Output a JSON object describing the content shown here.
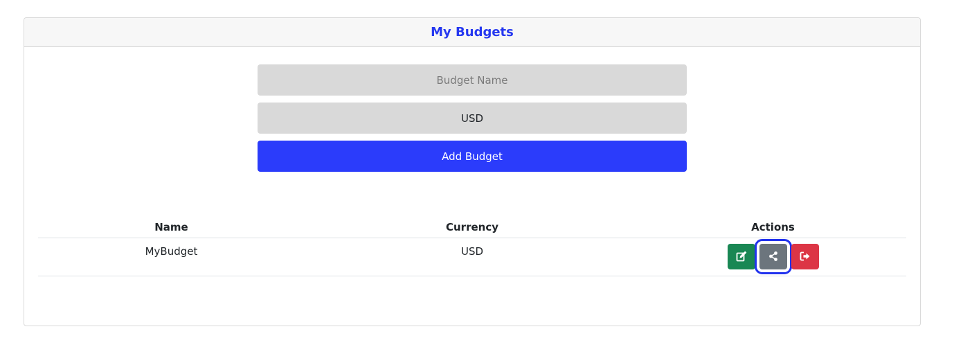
{
  "header": {
    "title": "My Budgets"
  },
  "form": {
    "name_placeholder": "Budget Name",
    "currency_value": "USD",
    "add_label": "Add Budget"
  },
  "table": {
    "columns": [
      "Name",
      "Currency",
      "Actions"
    ],
    "rows": [
      {
        "name": "MyBudget",
        "currency": "USD"
      }
    ]
  },
  "actions": {
    "edit_icon": "edit-icon",
    "share_icon": "share-icon",
    "leave_icon": "sign-out-icon"
  },
  "colors": {
    "accent": "#2b3cfb",
    "title": "#2638f0",
    "edit": "#198754",
    "share": "#6c757d",
    "leave": "#dc3545",
    "highlight": "#2233ee"
  }
}
